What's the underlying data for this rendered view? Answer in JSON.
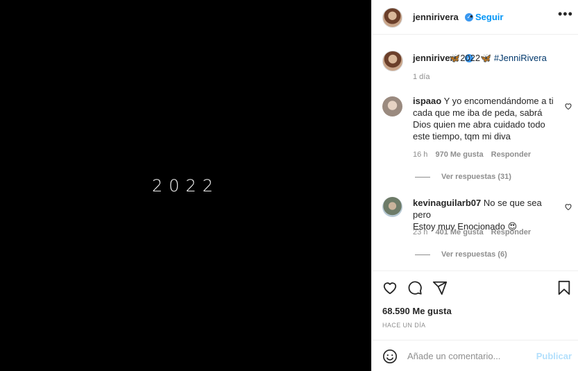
{
  "media": {
    "text": "2022"
  },
  "header": {
    "username": "jennirivera",
    "dot": "•",
    "follow_label": "Seguir",
    "more_icon": "more-horizontal-icon"
  },
  "caption": {
    "username": "jennirivera",
    "emoji_left": "🦋",
    "year": "2022",
    "emoji_right": "🦋",
    "hashtag": "#JenniRivera",
    "time": "1 día"
  },
  "comments": [
    {
      "username": "ispaao",
      "lines": [
        "Y yo encomendándome a ti",
        "cada que me iba de peda, sabrá",
        "Dios quien me abra cuidado todo",
        "este tiempo, tqm mi diva"
      ],
      "time": "16 h",
      "likes": "970 Me gusta",
      "reply": "Responder",
      "view_replies": "Ver respuestas (31)"
    },
    {
      "username": "kevinaguilarb07",
      "lines": [
        "No se que sea pero",
        "Estoy muy Enocionado 😍"
      ],
      "time": "23 h",
      "likes": "401 Me gusta",
      "reply": "Responder",
      "view_replies": "Ver respuestas (6)"
    }
  ],
  "actions": {
    "likes": "68.590 Me gusta",
    "when": "HACE UN DÍA"
  },
  "add_comment": {
    "placeholder": "Añade un comentario...",
    "publish_label": "Publicar"
  },
  "colors": {
    "link": "#0095f6",
    "muted": "#8e8e8e",
    "text": "#262626",
    "hashtag": "#00376b"
  }
}
